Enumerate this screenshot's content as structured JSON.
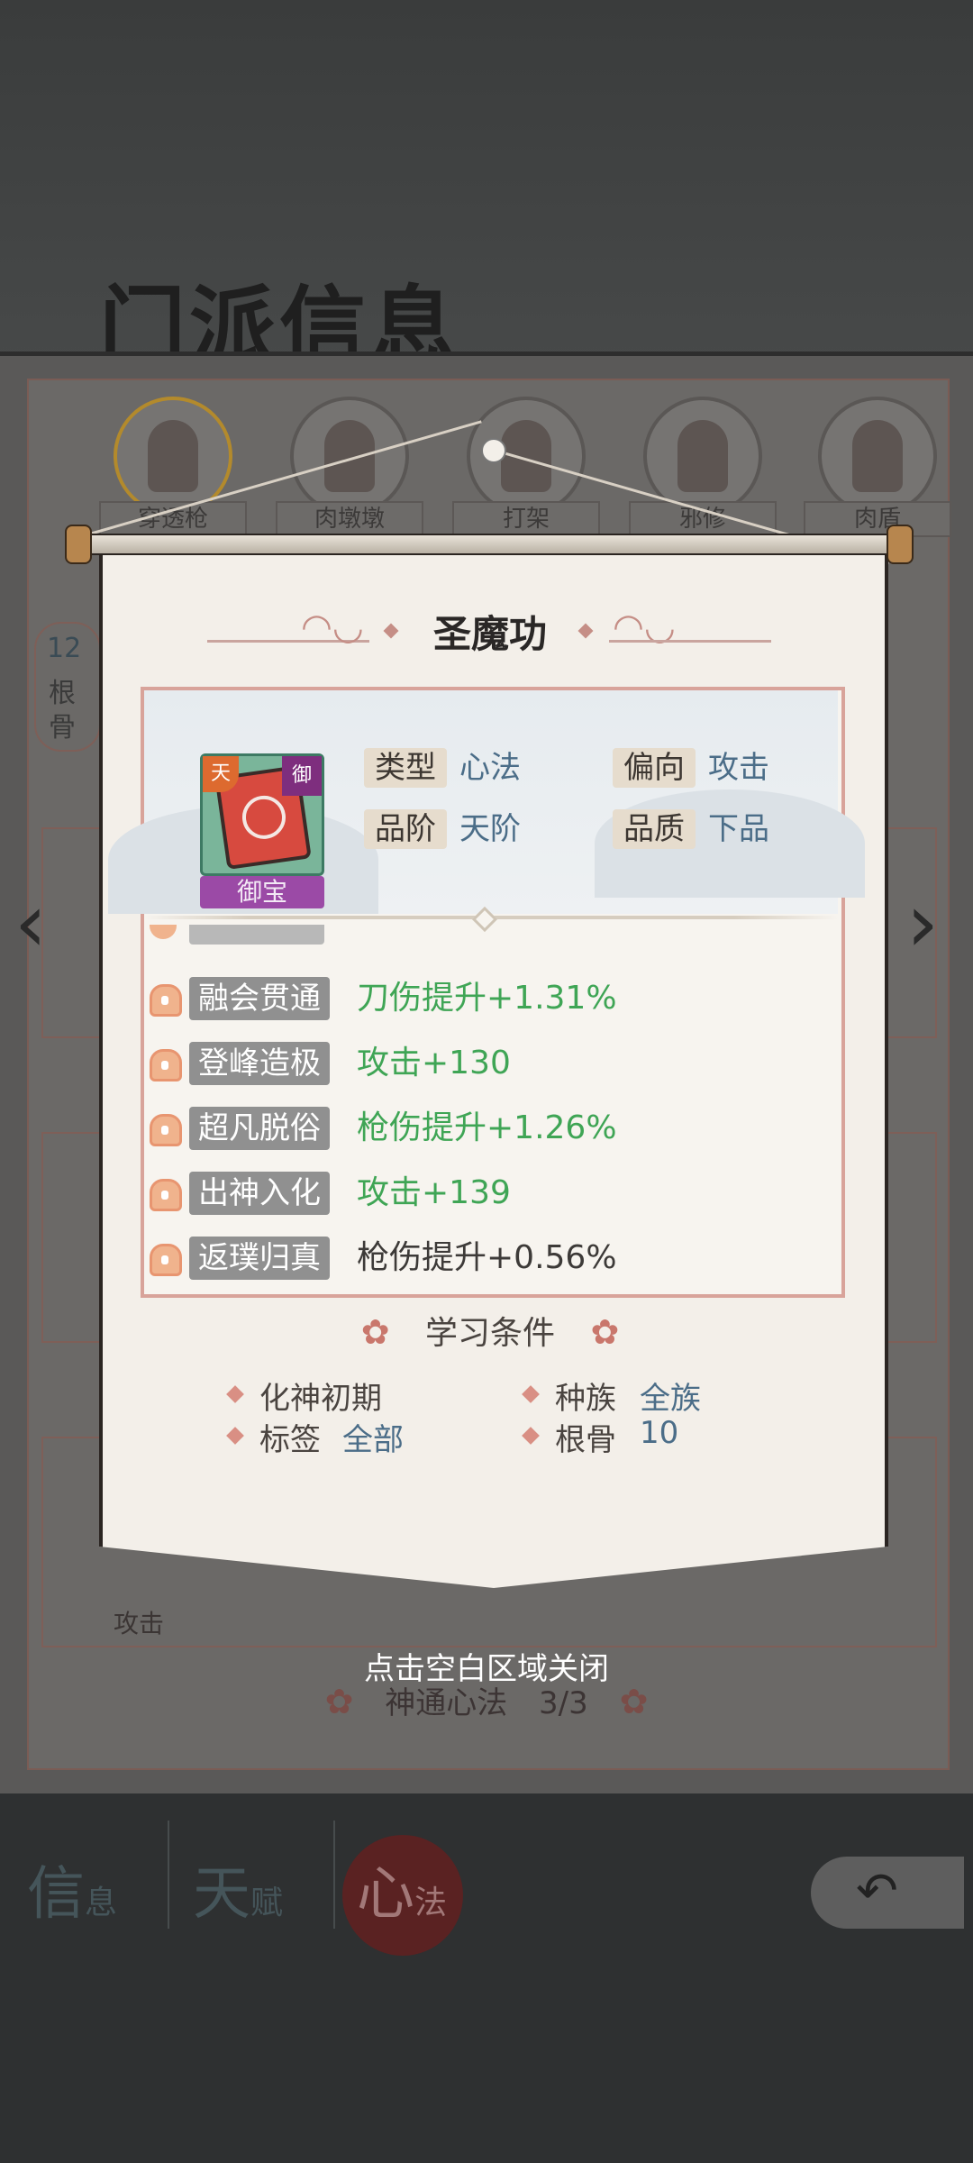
{
  "background": {
    "title": "门派信息",
    "characters": [
      "穿透枪",
      "肉墩墩",
      "打架",
      "邪修",
      "肉盾"
    ],
    "left_card_values": [
      "12",
      "根",
      "骨"
    ],
    "bottom_card_label": "攻击",
    "footer_text": "神通心法",
    "footer_count": "3/3",
    "tabs": [
      {
        "big": "信",
        "small": "息"
      },
      {
        "big": "天",
        "small": "赋"
      },
      {
        "big": "心",
        "small": "法"
      }
    ]
  },
  "popup": {
    "title": "圣魔功",
    "item": {
      "badge_left": "天",
      "badge_right": "御",
      "label": "御宝"
    },
    "attributes": [
      {
        "key": "类型",
        "value": "心法"
      },
      {
        "key": "偏向",
        "value": "攻击"
      },
      {
        "key": "品阶",
        "value": "天阶"
      },
      {
        "key": "品质",
        "value": "下品"
      }
    ],
    "levels": [
      {
        "name": "融会贯通",
        "effect": "刀伤提升+1.31%",
        "color": "green"
      },
      {
        "name": "登峰造极",
        "effect": "攻击+130",
        "color": "green"
      },
      {
        "name": "超凡脱俗",
        "effect": "枪伤提升+1.26%",
        "color": "green"
      },
      {
        "name": "出神入化",
        "effect": "攻击+139",
        "color": "green"
      },
      {
        "name": "返璞归真",
        "effect": "枪伤提升+0.56%",
        "color": "gray"
      }
    ],
    "conditions_title": "学习条件",
    "conditions": [
      {
        "key": "化神初期",
        "value": ""
      },
      {
        "key": "种族",
        "value": "全族"
      },
      {
        "key": "标签",
        "value": "全部"
      },
      {
        "key": "根骨",
        "value": "10"
      }
    ],
    "close_hint": "点击空白区域关闭"
  },
  "colors": {
    "effect_green": "#3fa555",
    "value_blue": "#4b6d88",
    "frame_pink": "#d8a39a",
    "item_purple": "#9b4aa6"
  }
}
